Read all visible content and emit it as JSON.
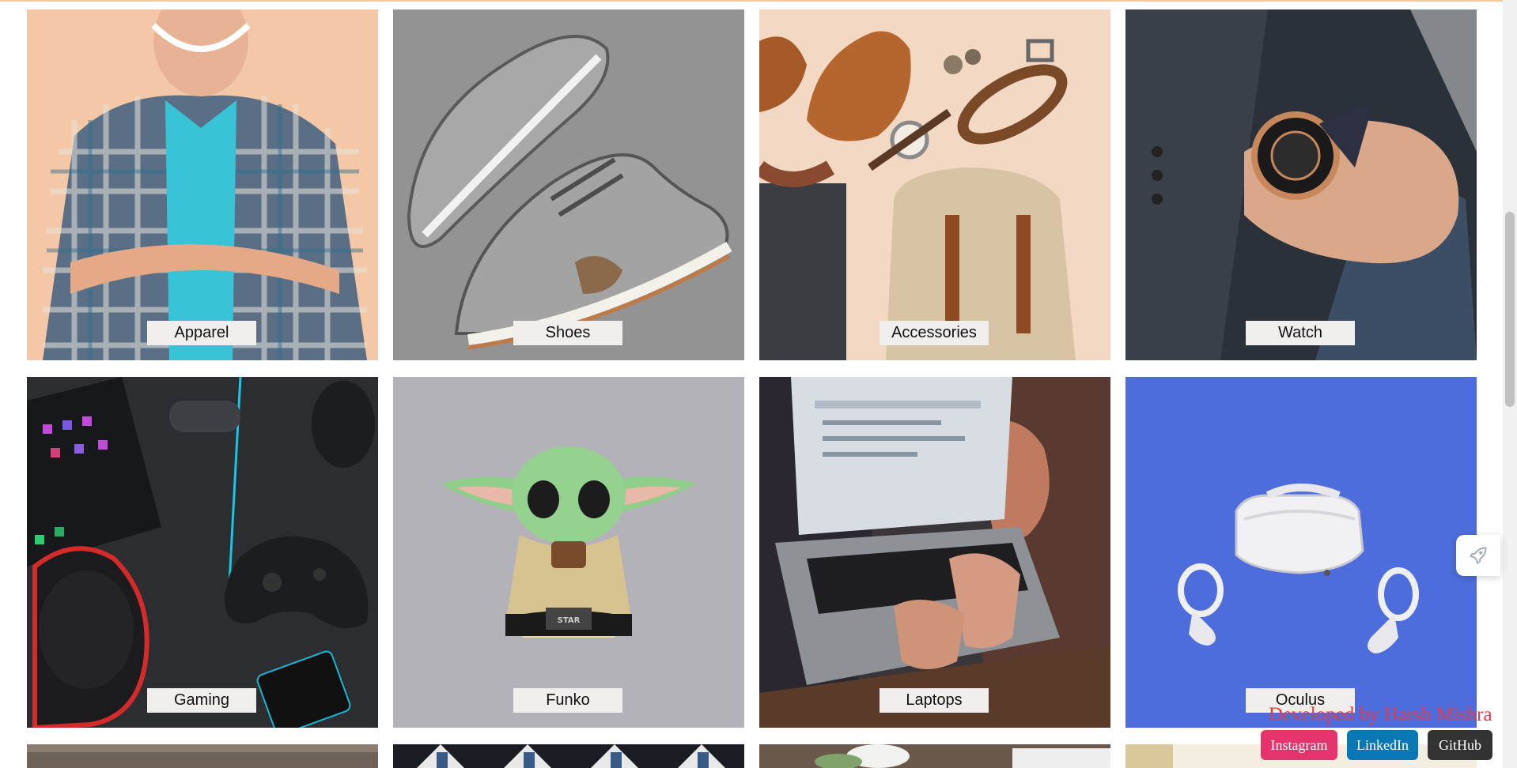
{
  "categories": [
    {
      "label": "Apparel"
    },
    {
      "label": "Shoes"
    },
    {
      "label": "Accessories"
    },
    {
      "label": "Watch"
    },
    {
      "label": "Gaming"
    },
    {
      "label": "Funko"
    },
    {
      "label": "Laptops"
    },
    {
      "label": "Oculus"
    }
  ],
  "footer": {
    "developer_credit": "Developed by Harsh Mishra",
    "links": {
      "instagram": "Instagram",
      "linkedin": "LinkedIn",
      "github": "GitHub"
    }
  },
  "colors": {
    "accent_red": "#e53945",
    "instagram": "#e5336e",
    "linkedin": "#0a77b5",
    "github": "#333333"
  },
  "icons": {
    "floating_button": "rocket-icon"
  }
}
